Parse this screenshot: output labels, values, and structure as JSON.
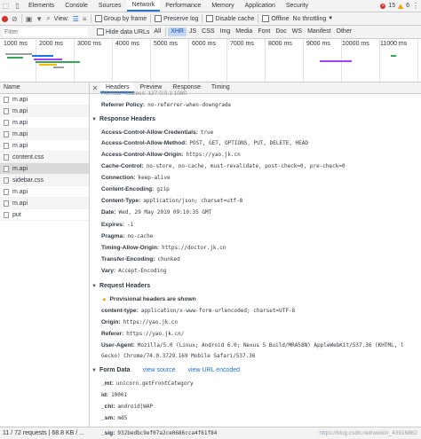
{
  "devtools": {
    "tabs": [
      "Elements",
      "Console",
      "Sources",
      "Network",
      "Performance",
      "Memory",
      "Application",
      "Security"
    ],
    "selected_tab": "Network",
    "error_count": "15",
    "warning_count": "6"
  },
  "toolbar": {
    "view_label": "View:",
    "group_by_frame": "Group by frame",
    "preserve_log": "Preserve log",
    "disable_cache": "Disable cache",
    "offline": "Offline",
    "throttling": "No throttling"
  },
  "filter": {
    "placeholder": "Filter",
    "hide_data_urls": "Hide data URLs",
    "types": [
      "All",
      "XHR",
      "JS",
      "CSS",
      "Img",
      "Media",
      "Font",
      "Doc",
      "WS",
      "Manifest",
      "Other"
    ],
    "selected_type": "XHR"
  },
  "overview": {
    "ticks": [
      "1000 ms",
      "2000 ms",
      "3000 ms",
      "4000 ms",
      "5000 ms",
      "6000 ms",
      "7000 ms",
      "8000 ms",
      "9000 ms",
      "10000 ms",
      "11000 ms"
    ]
  },
  "requests": {
    "header": "Name",
    "items": [
      "m.api",
      "m.api",
      "m.api",
      "m.api",
      "m.api",
      "content.css",
      "m.api",
      "sidebar.css",
      "m.api",
      "m.api",
      "put"
    ],
    "selected_index": 6
  },
  "details": {
    "tabs": [
      "Headers",
      "Preview",
      "Response",
      "Timing"
    ],
    "selected_tab": "Headers",
    "remote_address_partial": "Remote Address: 127.0.0.1:1080",
    "referrer_policy": {
      "key": "Referrer Policy:",
      "value": "no-referrer-when-downgrade"
    },
    "response_headers_title": "Response Headers",
    "response_headers": [
      {
        "key": "Access-Control-Allow-Credentials:",
        "value": "true"
      },
      {
        "key": "Access-Control-Allow-Method:",
        "value": "POST, GET, OPTIONS, PUT, DELETE, HEAD"
      },
      {
        "key": "Access-Control-Allow-Origin:",
        "value": "https://yao.jk.cn"
      },
      {
        "key": "Cache-Control:",
        "value": "no-store, no-cache, must-revalidate, post-check=0, pre-check=0"
      },
      {
        "key": "Connection:",
        "value": "keep-alive"
      },
      {
        "key": "Content-Encoding:",
        "value": "gzip"
      },
      {
        "key": "Content-Type:",
        "value": "application/json; charset=utf-8"
      },
      {
        "key": "Date:",
        "value": "Wed, 29 May 2019 09:10:35 GMT"
      },
      {
        "key": "Expires:",
        "value": "-1"
      },
      {
        "key": "Pragma:",
        "value": "no-cache"
      },
      {
        "key": "Timing-Allow-Origin:",
        "value": "https://doctor.jk.cn"
      },
      {
        "key": "Transfer-Encoding:",
        "value": "chunked"
      },
      {
        "key": "Vary:",
        "value": "Accept-Encoding"
      }
    ],
    "request_headers_title": "Request Headers",
    "provisional_warning": "Provisional headers are shown",
    "request_headers": [
      {
        "key": "content-type:",
        "value": "application/x-www-form-urlencoded; charset=UTF-8"
      },
      {
        "key": "Origin:",
        "value": "https://yao.jk.cn"
      },
      {
        "key": "Referer:",
        "value": "https://yao.jk.cn/"
      },
      {
        "key": "User-Agent:",
        "value": "Mozilla/5.0 (Linux; Android 6.0; Nexus 5 Build/MRA58N) AppleWebKit/537.36 (KHTML, l"
      },
      {
        "key": "",
        "value": "Gecko) Chrome/74.0.3729.169 Mobile Safari/537.36"
      }
    ],
    "form_data_title": "Form Data",
    "view_source": "view source",
    "view_url_encoded": "view URL encoded",
    "form_data": [
      {
        "key": "_mt:",
        "value": "unicorn.getFrontCategory"
      },
      {
        "key": "id:",
        "value": "10001"
      },
      {
        "key": "_chl:",
        "value": "android|WAP"
      },
      {
        "key": "_sm:",
        "value": "md5"
      },
      {
        "key": "_sig:",
        "value": "932bedbc9ef07a2ce0686cca4f61f84"
      }
    ]
  },
  "status": {
    "text": "11 / 72 requests  |  68.8 KB / ...",
    "watermark": "https://blog.csdn.net/weixin_43916862"
  },
  "colors": {
    "accent": "#1a73e8",
    "error": "#d93025",
    "warning": "#f0a500",
    "selected_row": "#dadada"
  }
}
